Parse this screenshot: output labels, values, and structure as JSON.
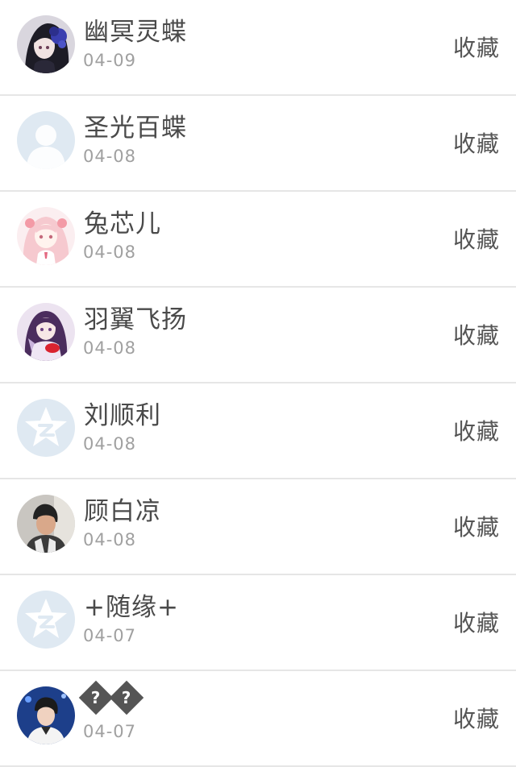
{
  "colors": {
    "name": "#4a4a4a",
    "date": "#a0a0a0",
    "action": "#555555",
    "divider": "#e6e6e6",
    "default_avatar_bg": "#dfe9f2"
  },
  "items": [
    {
      "name": "幽冥灵蝶",
      "date": "04-09",
      "action": "收藏",
      "avatar": "anime-dark-hair-avatar"
    },
    {
      "name": "圣光百蝶",
      "date": "04-08",
      "action": "收藏",
      "avatar": "default-person-avatar"
    },
    {
      "name": "兔芯儿",
      "date": "04-08",
      "action": "收藏",
      "avatar": "anime-pink-girl-avatar"
    },
    {
      "name": "羽翼飞扬",
      "date": "04-08",
      "action": "收藏",
      "avatar": "anime-purple-girl-avatar"
    },
    {
      "name": "刘顺利",
      "date": "04-08",
      "action": "收藏",
      "avatar": "qzone-star-avatar"
    },
    {
      "name": "顾白凉",
      "date": "04-08",
      "action": "收藏",
      "avatar": "boy-photo-avatar"
    },
    {
      "name": "+随缘+",
      "date": "04-07",
      "action": "收藏",
      "avatar": "qzone-star-avatar"
    },
    {
      "name": "",
      "glyph": "?",
      "date": "04-07",
      "action": "收藏",
      "avatar": "boy-stage-photo-avatar"
    }
  ]
}
